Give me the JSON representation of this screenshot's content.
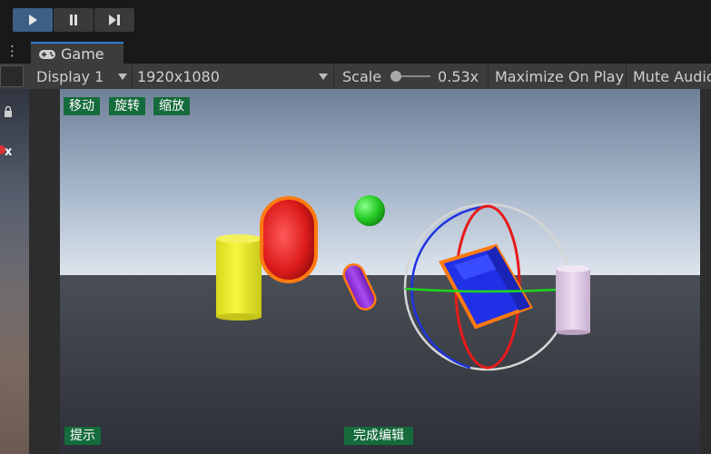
{
  "toolbar": {
    "play_icon": "play-icon",
    "pause_icon": "pause-icon",
    "step_icon": "step-icon",
    "accent_color": "#3d5f86"
  },
  "tab": {
    "title": "Game",
    "icon": "gamepad-icon",
    "accent_color": "#2d7ad6"
  },
  "game_options": {
    "display": "Display 1",
    "resolution": "1920x1080",
    "scale_label": "Scale",
    "scale_value": "0.53x",
    "maximize": "Maximize On Play",
    "mute": "Mute Audio"
  },
  "left_panel": {
    "close_label": "x"
  },
  "game_ui": {
    "buttons": [
      "移动",
      "旋转",
      "缩放"
    ],
    "hint_button": "提示",
    "done_button": "完成编辑",
    "button_color": "#156b3b"
  }
}
